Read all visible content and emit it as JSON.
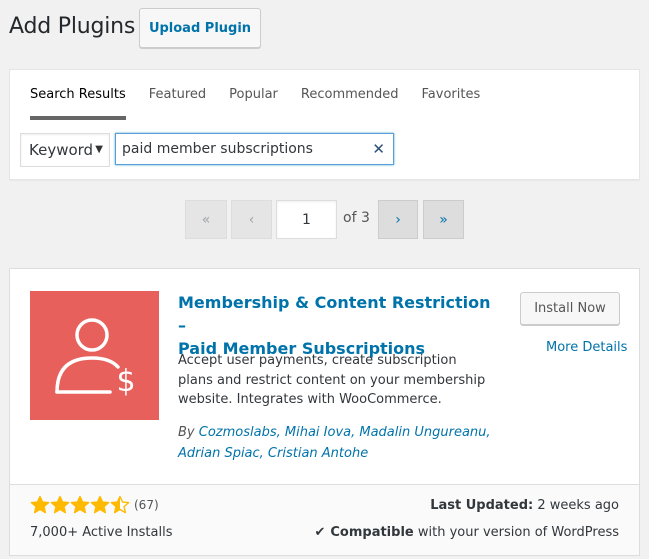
{
  "header": {
    "title": "Add Plugins",
    "upload_label": "Upload Plugin"
  },
  "filter": {
    "tabs": [
      "Search Results",
      "Featured",
      "Popular",
      "Recommended",
      "Favorites"
    ],
    "current_tab": "Search Results",
    "search_type": "Keyword",
    "search_value": "paid member subscriptions"
  },
  "pagination": {
    "first": "«",
    "prev": "‹",
    "current_page": "1",
    "total_text": "of 3",
    "next": "›",
    "last": "»"
  },
  "plugin": {
    "title_line1": "Membership & Content Restriction –",
    "title_line2": "Paid Member Subscriptions",
    "install_label": "Install Now",
    "more_details_label": "More Details",
    "description": "Accept user payments, create subscription plans and restrict content on your membership website. Integrates with WooCommerce.",
    "by_label": "By",
    "authors_text": "Cozmoslabs, Mihai Iova, Madalin Ungureanu, Adrian Spiac, Cristian Antohe",
    "rating_value": 4.5,
    "rating_count": "(67)",
    "active_installs": "7,000+ Active Installs",
    "last_updated_label": "Last Updated:",
    "last_updated_value": "2 weeks ago",
    "compatible_label": "Compatible",
    "compatible_rest": "with your version of WordPress",
    "icon": "user-dollar-icon",
    "icon_bg": "#e8605b",
    "star_color": "#ffb900"
  }
}
